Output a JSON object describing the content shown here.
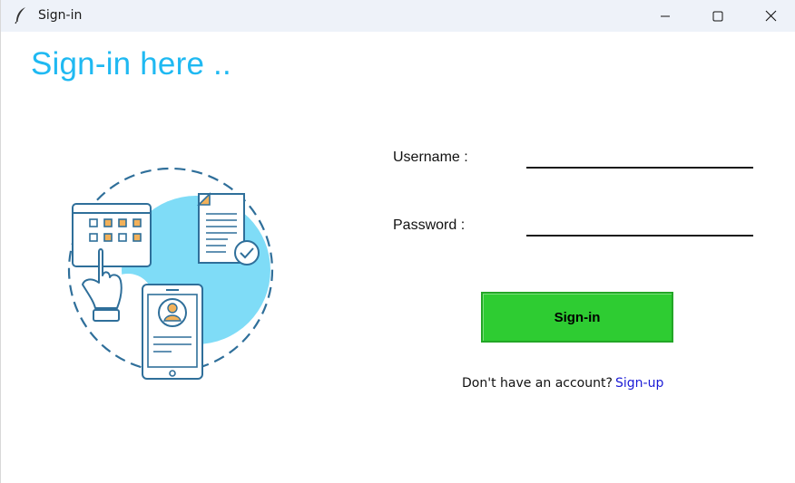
{
  "window": {
    "title": "Sign-in",
    "icon": "feather-icon",
    "controls": [
      "minimize-icon",
      "maximize-icon",
      "close-icon"
    ]
  },
  "page": {
    "heading": "Sign-in here .."
  },
  "illustration": {
    "icon": "online-registration-illustration"
  },
  "form": {
    "username_label": "Username :",
    "username_value": "",
    "password_label": "Password :",
    "password_value": "",
    "submit_label": "Sign-in"
  },
  "footer": {
    "prompt_text": "Don't have an account?",
    "link_label": "Sign-up"
  },
  "colors": {
    "heading": "#1fb9f2",
    "button": "#2ecc32",
    "link": "#1a1ad6",
    "illustration_line": "#2f6f9a",
    "illustration_fill": "#7fdcf7",
    "illustration_accent": "#f2b15a"
  }
}
